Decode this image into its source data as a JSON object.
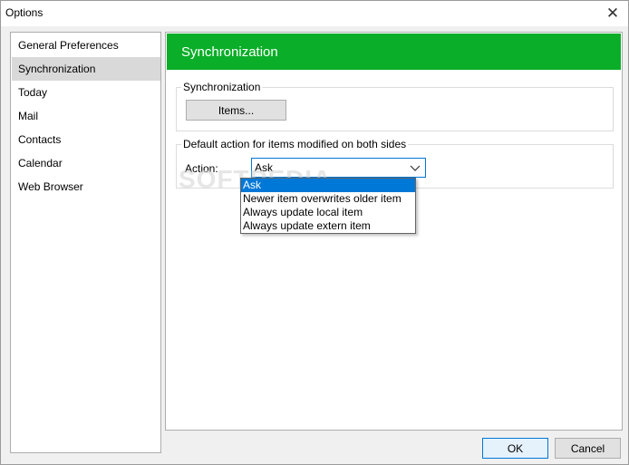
{
  "window": {
    "title": "Options",
    "close_glyph": "✕"
  },
  "sidebar": {
    "items": [
      {
        "label": "General Preferences"
      },
      {
        "label": "Synchronization",
        "selected": true
      },
      {
        "label": "Today"
      },
      {
        "label": "Mail"
      },
      {
        "label": "Contacts"
      },
      {
        "label": "Calendar"
      },
      {
        "label": "Web Browser"
      }
    ]
  },
  "content": {
    "header_title": "Synchronization",
    "header_color": "#0aae28",
    "sync_group": {
      "label": "Synchronization",
      "items_button": "Items..."
    },
    "default_action_group": {
      "label": "Default action for items  modified on both sides",
      "action_label": "Action:",
      "selected_value": "Ask",
      "options": [
        "Ask",
        "Newer item overwrites older item",
        "Always update local item",
        "Always update extern item"
      ]
    }
  },
  "watermark": "SOFTPEDIA",
  "footer": {
    "ok_label": "OK",
    "cancel_label": "Cancel"
  },
  "colors": {
    "accent": "#0078d7",
    "selected_item_bg": "#d9d9d9"
  }
}
